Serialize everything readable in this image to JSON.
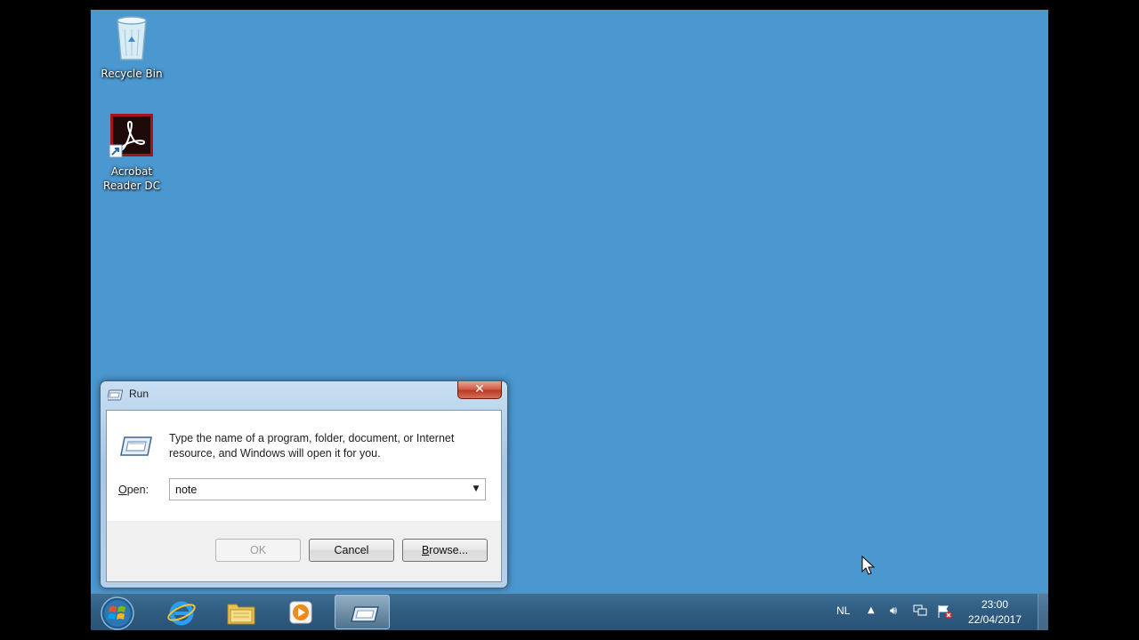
{
  "desktop": {
    "icons": [
      {
        "label": "Recycle Bin",
        "icon": "recycle-bin-icon"
      },
      {
        "label_line1": "Acrobat",
        "label_line2": "Reader DC",
        "icon": "acrobat-reader-icon"
      }
    ],
    "background_color": "#4b97cf"
  },
  "run_dialog": {
    "title": "Run",
    "close_label": "✕",
    "description": "Type the name of a program, folder, document, or Internet resource, and Windows will open it for you.",
    "open_label_prefix": "",
    "open_label_accel": "O",
    "open_label_rest": "pen:",
    "open_value": "note",
    "buttons": {
      "ok": "OK",
      "cancel": "Cancel",
      "browse_accel": "B",
      "browse_rest": "rowse..."
    }
  },
  "taskbar": {
    "language": "NL",
    "time": "23:00",
    "date": "22/04/2017",
    "pinned": [
      "start-orb-icon",
      "internet-explorer-icon",
      "file-explorer-icon",
      "media-player-icon",
      "run-icon"
    ]
  }
}
